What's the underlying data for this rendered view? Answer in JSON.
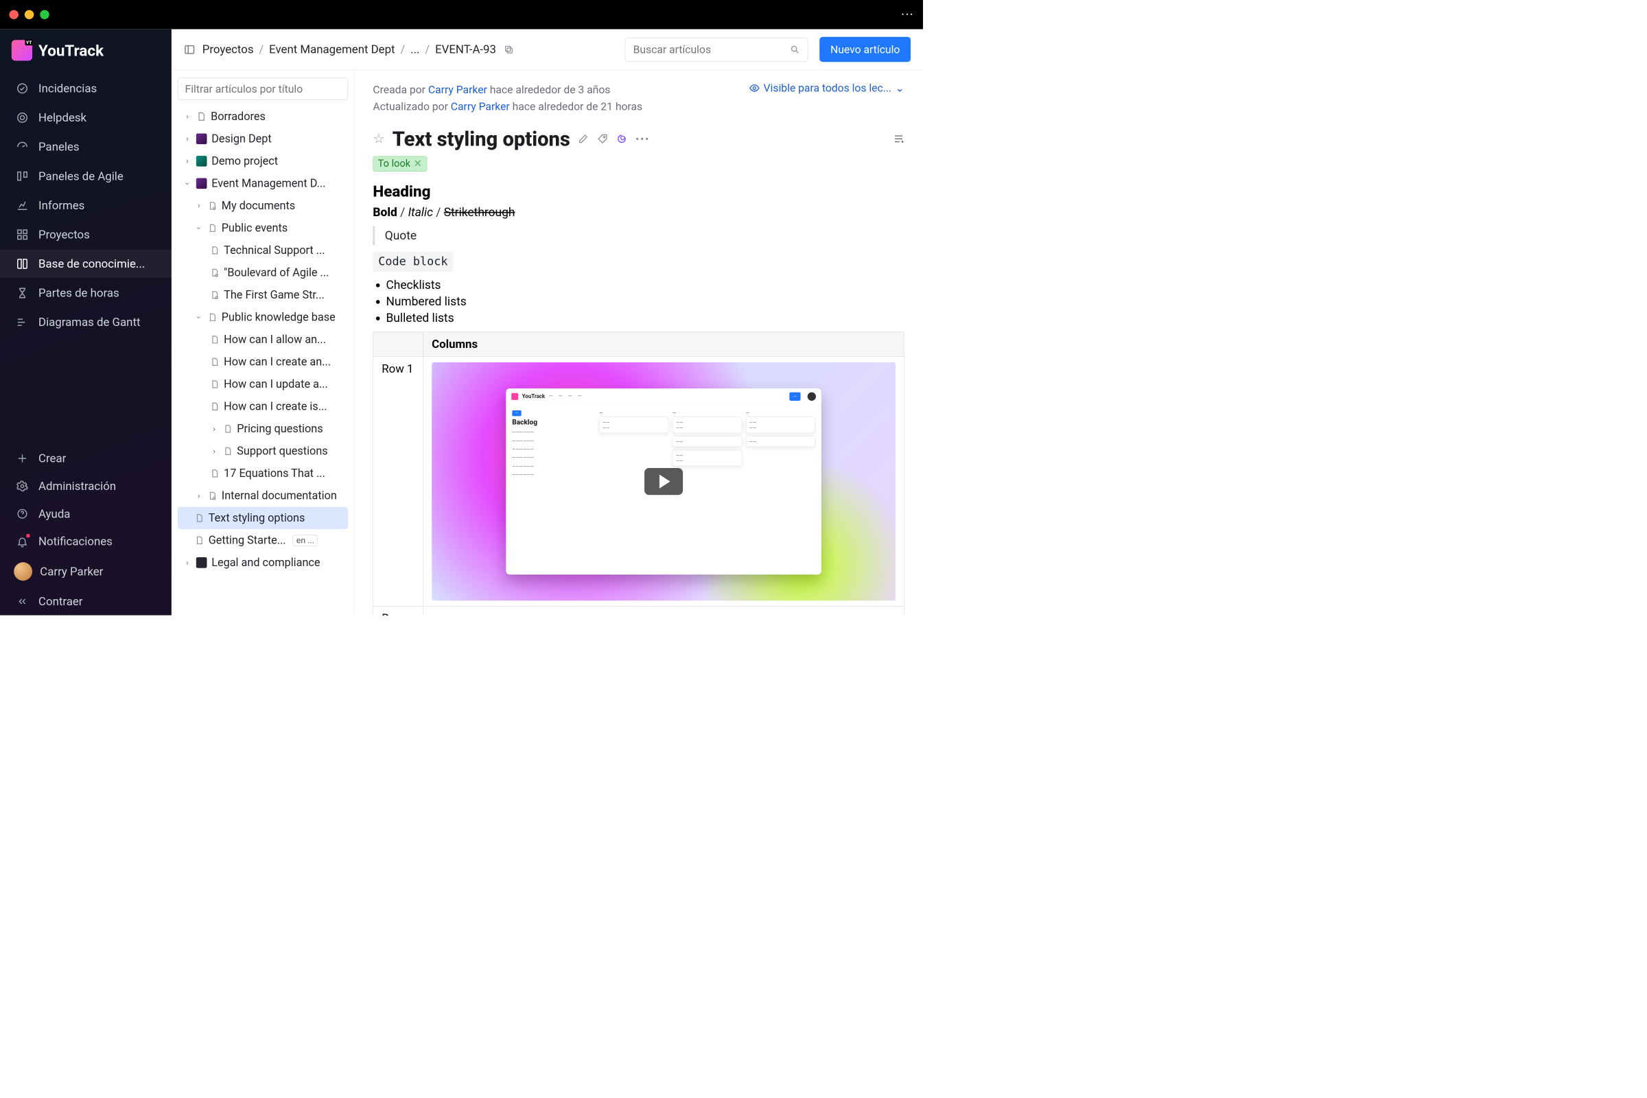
{
  "brand": {
    "name": "YouTrack"
  },
  "nav": {
    "items": [
      "Incidencias",
      "Helpdesk",
      "Paneles",
      "Paneles de Agile",
      "Informes",
      "Proyectos",
      "Base de conocimie...",
      "Partes de horas",
      "Diagramas de Gantt"
    ],
    "bottom": [
      "Crear",
      "Administración",
      "Ayuda",
      "Notificaciones"
    ],
    "user": "Carry Parker",
    "collapse": "Contraer"
  },
  "topbar": {
    "crumbs": [
      "Proyectos",
      "Event Management Dept",
      "...",
      "EVENT-A-93"
    ],
    "search_placeholder": "Buscar artículos",
    "new_article": "Nuevo artículo"
  },
  "tree": {
    "filter_placeholder": "Filtrar artículos por título",
    "items": {
      "drafts": "Borradores",
      "design": "Design Dept",
      "demo": "Demo project",
      "event": "Event Management D...",
      "mydocs": "My documents",
      "public_events": "Public events",
      "pe": [
        "Technical Support ...",
        "\"Boulevard of Agile ...",
        "The First Game Str..."
      ],
      "pkb": "Public knowledge base",
      "kb": [
        "How can I allow an...",
        "How can I create an...",
        "How can I update a...",
        "How can I create is...",
        "Pricing questions",
        "Support questions",
        "17 Equations That ..."
      ],
      "internal": "Internal documentation",
      "text_styling": "Text styling options",
      "getting": "Getting Starte...",
      "getting_badge": "en ...",
      "legal": "Legal and compliance"
    }
  },
  "article": {
    "created_by_label": "Creada por",
    "created_by": "Carry Parker",
    "created_ago": "hace alrededor de 3 años",
    "updated_by_label": "Actualizado por",
    "updated_by": "Carry Parker",
    "updated_ago": "hace alrededor de 21 horas",
    "visibility": "Visible para todos los lec...",
    "title": "Text styling options",
    "tag": "To look",
    "heading": "Heading",
    "bold": "Bold",
    "italic": "Italic",
    "strike": "Strikethrough",
    "quote": "Quote",
    "code": "Code block",
    "lists": [
      "Checklists",
      "Numbered lists",
      "Bulleted lists"
    ],
    "table": {
      "col_header": "Columns",
      "row1": "Row 1",
      "row2": "Row"
    }
  },
  "thumb": {
    "brand": "YouTrack",
    "backlog": "Backlog"
  }
}
